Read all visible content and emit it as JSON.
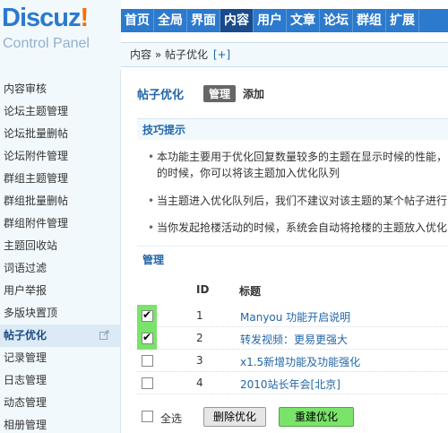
{
  "brand": {
    "name": "Discuz",
    "bang": "!",
    "subtitle": "Control Panel"
  },
  "nav": [
    "首页",
    "全局",
    "界面",
    "内容",
    "用户",
    "文章",
    "论坛",
    "群组",
    "扩展"
  ],
  "nav_active": "内容",
  "breadcrumb": {
    "text": "内容 » 帖子优化",
    "plus": "[+]"
  },
  "sidebar": {
    "items": [
      "内容审核",
      "论坛主题管理",
      "论坛批量删帖",
      "论坛附件管理",
      "群组主题管理",
      "群组批量删帖",
      "群组附件管理",
      "主题回收站",
      "词语过滤",
      "用户举报",
      "多版块置顶",
      "帖子优化",
      "记录管理",
      "日志管理",
      "动态管理",
      "相册管理"
    ],
    "active": "帖子优化"
  },
  "page": {
    "title": "帖子优化",
    "tab_manage": "管理",
    "tab_add": "添加"
  },
  "tips": {
    "heading": "技巧提示",
    "items": [
      "本功能主要用于优化回复数量较多的主题在显示时候的性能，",
      "的时候，你可以将该主题加入优化队列",
      "当主题进入优化队列后，我们不建议对该主题的某个帖子进行",
      "当你发起抢楼活动的时候，系统会自动将抢楼的主题放入优化"
    ]
  },
  "manage": {
    "heading": "管理",
    "col_id": "ID",
    "col_title": "标题",
    "rows": [
      {
        "id": "1",
        "title": "Manyou 功能开启说明",
        "checked": true
      },
      {
        "id": "2",
        "title": "转发视频：更易更强大",
        "checked": true
      },
      {
        "id": "3",
        "title": "x1.5新增功能及功能强化",
        "checked": false
      },
      {
        "id": "4",
        "title": "2010站长年会[北京]",
        "checked": false
      }
    ],
    "select_all": "全选",
    "delete_button": "删除优化",
    "rebuild_button": "重建优化"
  },
  "colors": {
    "nav_bg": "#2b7acd",
    "nav_active": "#1a4a8a",
    "highlight": "#7ae36a",
    "link": "#2366a8"
  }
}
